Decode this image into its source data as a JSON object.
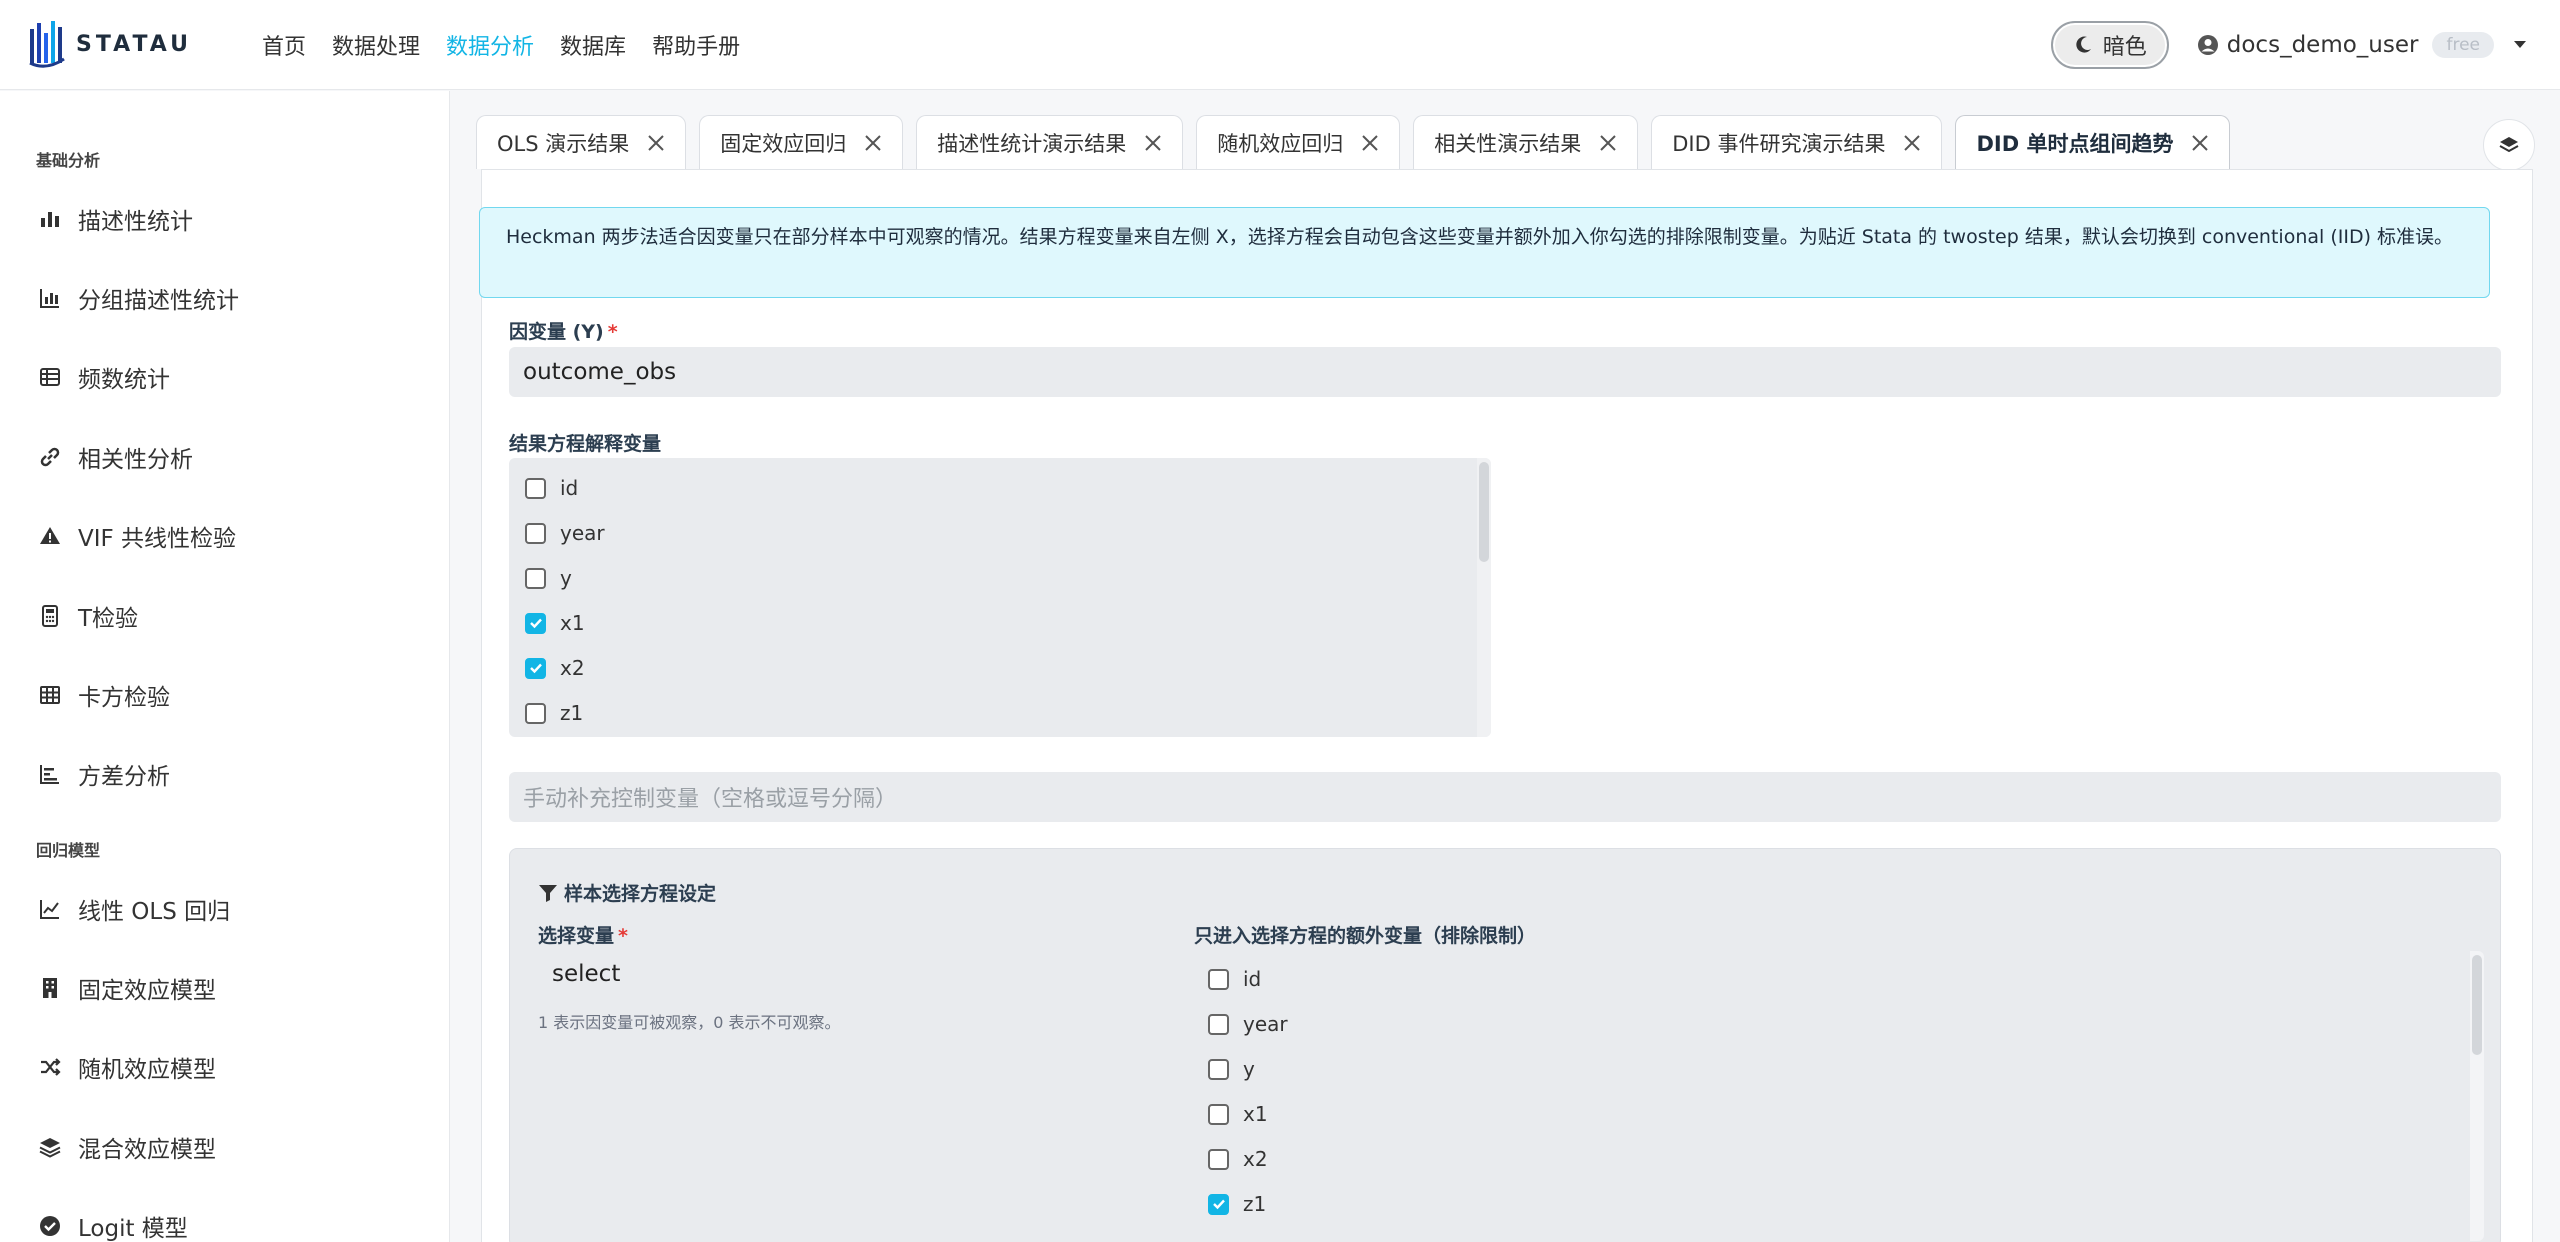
{
  "brand": {
    "name": "STATAU"
  },
  "nav": {
    "links": [
      "首页",
      "数据处理",
      "数据分析",
      "数据库",
      "帮助手册"
    ],
    "active_index": 2,
    "theme_label": "暗色",
    "username": "docs_demo_user",
    "plan_badge": "free"
  },
  "sidebar": {
    "section_basic": "基础分析",
    "basic_items": [
      "描述性统计",
      "分组描述性统计",
      "频数统计",
      "相关性分析",
      "VIF 共线性检验",
      "T检验",
      "卡方检验",
      "方差分析"
    ],
    "section_regression": "回归模型",
    "regression_items": [
      "线性 OLS 回归",
      "固定效应模型",
      "随机效应模型",
      "混合效应模型",
      "Logit 模型"
    ]
  },
  "tabs": [
    {
      "label": "OLS 演示结果"
    },
    {
      "label": "固定效应回归"
    },
    {
      "label": "描述性统计演示结果"
    },
    {
      "label": "随机效应回归"
    },
    {
      "label": "相关性演示结果"
    },
    {
      "label": "DID 事件研究演示结果"
    },
    {
      "label": "DID 单时点组间趋势",
      "active": true
    }
  ],
  "form": {
    "info_text": "Heckman 两步法适合因变量只在部分样本中可观察的情况。结果方程变量来自左侧 X，选择方程会自动包含这些变量并额外加入你勾选的排除限制变量。为贴近 Stata 的 twostep 结果，默认会切换到 conventional (IID) 标准误。",
    "dv_label": "因变量 (Y)",
    "dv_value": "outcome_obs",
    "outcome_vars_label": "结果方程解释变量",
    "outcome_vars": [
      {
        "name": "id",
        "checked": false
      },
      {
        "name": "year",
        "checked": false
      },
      {
        "name": "y",
        "checked": false
      },
      {
        "name": "x1",
        "checked": true
      },
      {
        "name": "x2",
        "checked": true
      },
      {
        "name": "z1",
        "checked": false
      }
    ],
    "controls_placeholder": "手动补充控制变量（空格或逗号分隔）",
    "sample_section_title": "样本选择方程设定",
    "select_label": "选择变量",
    "select_value": "select",
    "select_hint": "1 表示因变量可被观察，0 表示不可观察。",
    "extra_vars_label": "只进入选择方程的额外变量（排除限制）",
    "extra_vars": [
      {
        "name": "id",
        "checked": false
      },
      {
        "name": "year",
        "checked": false
      },
      {
        "name": "y",
        "checked": false
      },
      {
        "name": "x1",
        "checked": false
      },
      {
        "name": "x2",
        "checked": false
      },
      {
        "name": "z1",
        "checked": true
      }
    ]
  },
  "colors": {
    "accent": "#12b5e5",
    "info_bg": "#dff8fd",
    "info_border": "#72d8ef",
    "required": "#e53935"
  }
}
